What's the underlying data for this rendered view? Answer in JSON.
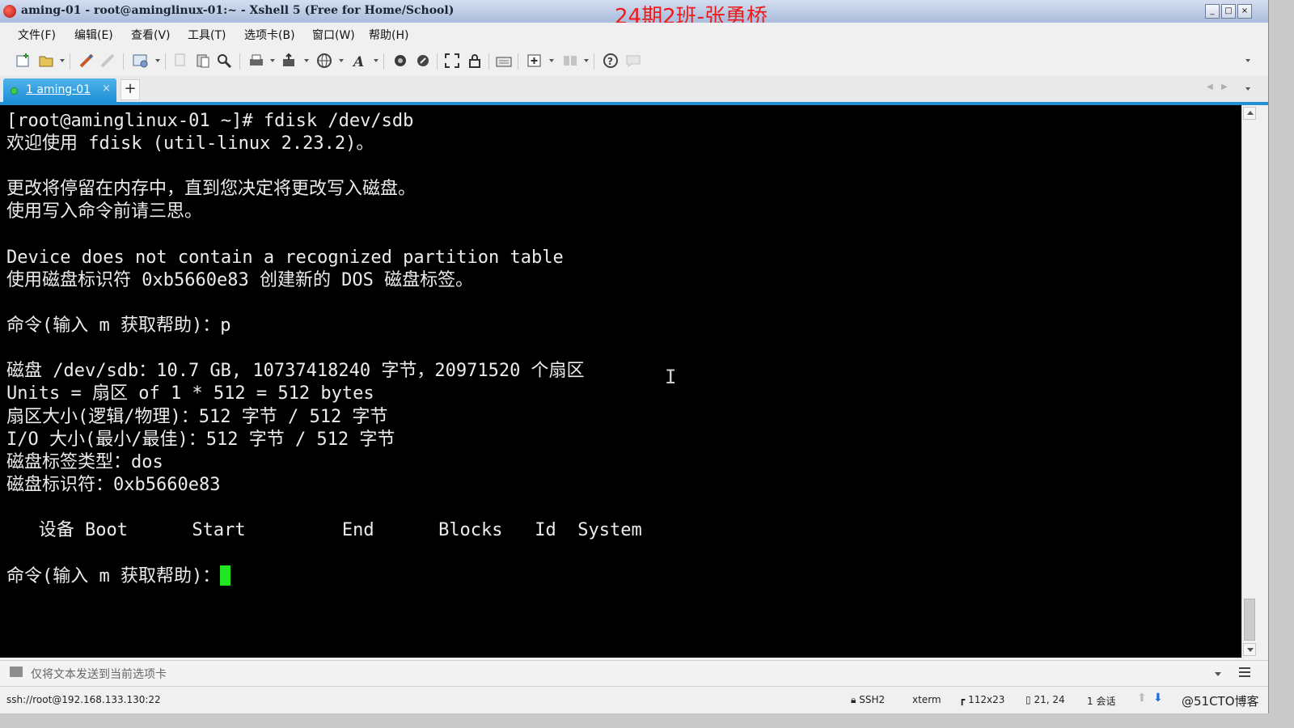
{
  "window": {
    "title": "aming-01 - root@aminglinux-01:~ - Xshell 5 (Free for Home/School)",
    "overlay_caption": "24期2班-张勇桥",
    "controls": [
      "_",
      "□",
      "×"
    ]
  },
  "menu": [
    "文件(F)",
    "编辑(E)",
    "查看(V)",
    "工具(T)",
    "选项卡(B)",
    "窗口(W)",
    "帮助(H)"
  ],
  "toolbar": {
    "icons": [
      "new-session-icon",
      "open-folder-icon",
      "connect-icon",
      "disconnect-icon",
      "session-properties-icon",
      "copy-icon",
      "paste-icon",
      "find-icon",
      "print-icon",
      "transfer-icon",
      "globe-icon",
      "font-icon",
      "record-icon",
      "script-icon",
      "fullscreen-icon",
      "lock-icon",
      "keyboard-icon",
      "new-tab-icon",
      "layout-icon",
      "help-icon",
      "chat-icon"
    ]
  },
  "tabs": [
    {
      "label": "1 aming-01",
      "active": true,
      "status_color": "#3ecf48"
    }
  ],
  "tab_close": "×",
  "tab_add": "+",
  "terminal": {
    "background": "#000000",
    "foreground": "#ececec",
    "cursor_color": "#21e521",
    "lines": [
      "[root@aminglinux-01 ~]# fdisk /dev/sdb",
      "欢迎使用 fdisk (util-linux 2.23.2)。",
      "",
      "更改将停留在内存中，直到您决定将更改写入磁盘。",
      "使用写入命令前请三思。",
      "",
      "Device does not contain a recognized partition table",
      "使用磁盘标识符 0xb5660e83 创建新的 DOS 磁盘标签。",
      "",
      "命令(输入 m 获取帮助)：p",
      "",
      "磁盘 /dev/sdb：10.7 GB, 10737418240 字节，20971520 个扇区",
      "Units = 扇区 of 1 * 512 = 512 bytes",
      "扇区大小(逻辑/物理)：512 字节 / 512 字节",
      "I/O 大小(最小/最佳)：512 字节 / 512 字节",
      "磁盘标签类型：dos",
      "磁盘标识符：0xb5660e83",
      "",
      "   设备 Boot      Start         End      Blocks   Id  System",
      "",
      "命令(输入 m 获取帮助)："
    ]
  },
  "send_bar": {
    "text": "仅将文本发送到当前选项卡"
  },
  "status": {
    "connection": "ssh://root@192.168.133.130:22",
    "protocol": "SSH2",
    "terminal_type": "xterm",
    "size": "112x23",
    "cursor_pos": "21, 24",
    "sessions": "1 会话",
    "site_mark": "@51CTO博客"
  },
  "colors": {
    "accent": "#1f8fd6",
    "watermark": "#ee1b1b"
  }
}
